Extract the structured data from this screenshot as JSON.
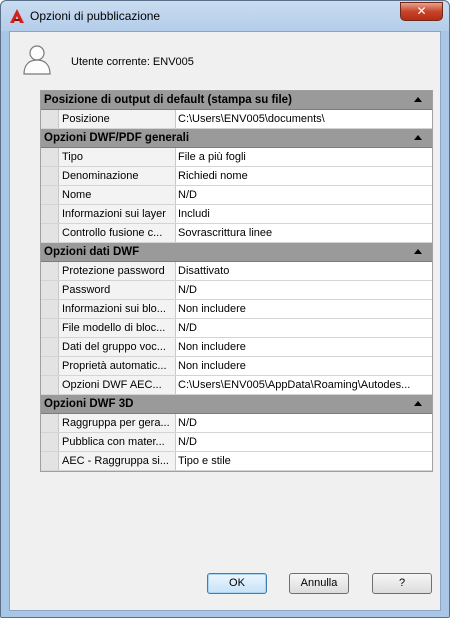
{
  "window": {
    "title": "Opzioni di pubblicazione",
    "close_glyph": "✕",
    "accent": "#b52d14",
    "app_icon": "autocad-a-icon"
  },
  "user": {
    "label": "Utente corrente: ENV005",
    "icon": "user-silhouette-icon"
  },
  "categories": [
    {
      "title": "Posizione di output di default (stampa su file)",
      "rows": [
        {
          "name": "Posizione",
          "value": "C:\\Users\\ENV005\\documents\\"
        }
      ]
    },
    {
      "title": "Opzioni DWF/PDF generali",
      "rows": [
        {
          "name": "Tipo",
          "value": "File a più fogli"
        },
        {
          "name": "Denominazione",
          "value": "Richiedi nome"
        },
        {
          "name": "Nome",
          "value": "N/D"
        },
        {
          "name": "Informazioni sui layer",
          "value": "Includi"
        },
        {
          "name": "Controllo fusione c...",
          "value": "Sovrascrittura linee"
        }
      ]
    },
    {
      "title": "Opzioni dati DWF",
      "rows": [
        {
          "name": "Protezione password",
          "value": "Disattivato"
        },
        {
          "name": "Password",
          "value": "N/D"
        },
        {
          "name": "Informazioni sui blo...",
          "value": "Non includere"
        },
        {
          "name": "File modello di bloc...",
          "value": "N/D"
        },
        {
          "name": "Dati del gruppo voc...",
          "value": "Non includere"
        },
        {
          "name": "Proprietà automatic...",
          "value": "Non includere"
        },
        {
          "name": "Opzioni DWF AEC...",
          "value": "C:\\Users\\ENV005\\AppData\\Roaming\\Autodes..."
        }
      ]
    },
    {
      "title": "Opzioni DWF 3D",
      "rows": [
        {
          "name": "Raggruppa per gera...",
          "value": "N/D"
        },
        {
          "name": "Pubblica con mater...",
          "value": "N/D"
        },
        {
          "name": "AEC - Raggruppa si...",
          "value": "Tipo e stile"
        }
      ]
    }
  ],
  "buttons": {
    "ok": "OK",
    "cancel": "Annulla",
    "help": "?"
  }
}
